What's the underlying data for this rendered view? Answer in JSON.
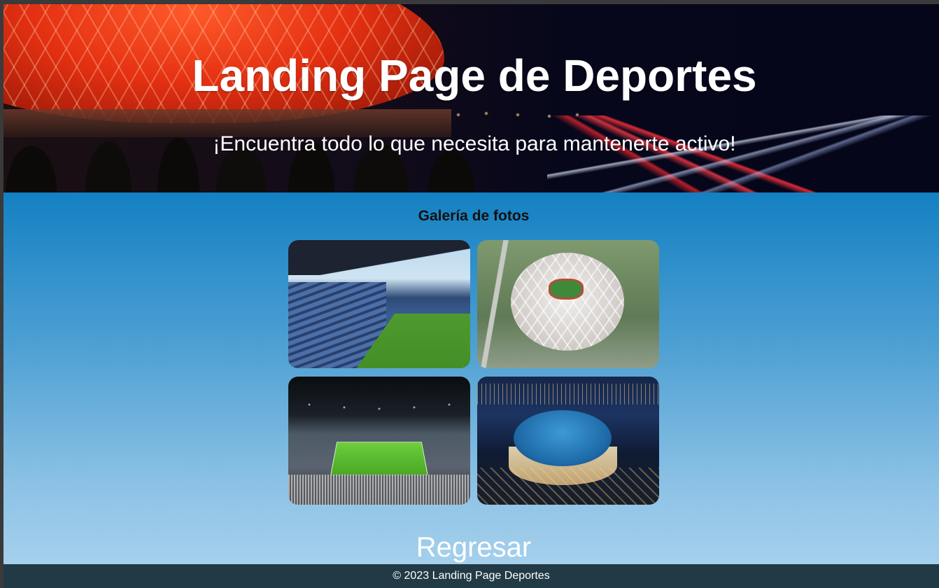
{
  "hero": {
    "title": "Landing Page de Deportes",
    "subtitle": "¡Encuentra todo lo que necesita para mantenerte activo!"
  },
  "gallery": {
    "heading": "Galería de fotos",
    "photos": [
      {
        "alt": "stadium-interior-day"
      },
      {
        "alt": "stadium-aerial-white"
      },
      {
        "alt": "stadium-interior-night"
      },
      {
        "alt": "stadium-aerial-night"
      }
    ]
  },
  "nav": {
    "back_label": "Regresar"
  },
  "footer": {
    "copyright": "© 2023 Landing Page Deportes"
  },
  "colors": {
    "page_bg_top": "#1480c2",
    "page_bg_bottom": "#a5d0ec",
    "footer_bg": "#223a45",
    "text_light": "#ffffff"
  }
}
